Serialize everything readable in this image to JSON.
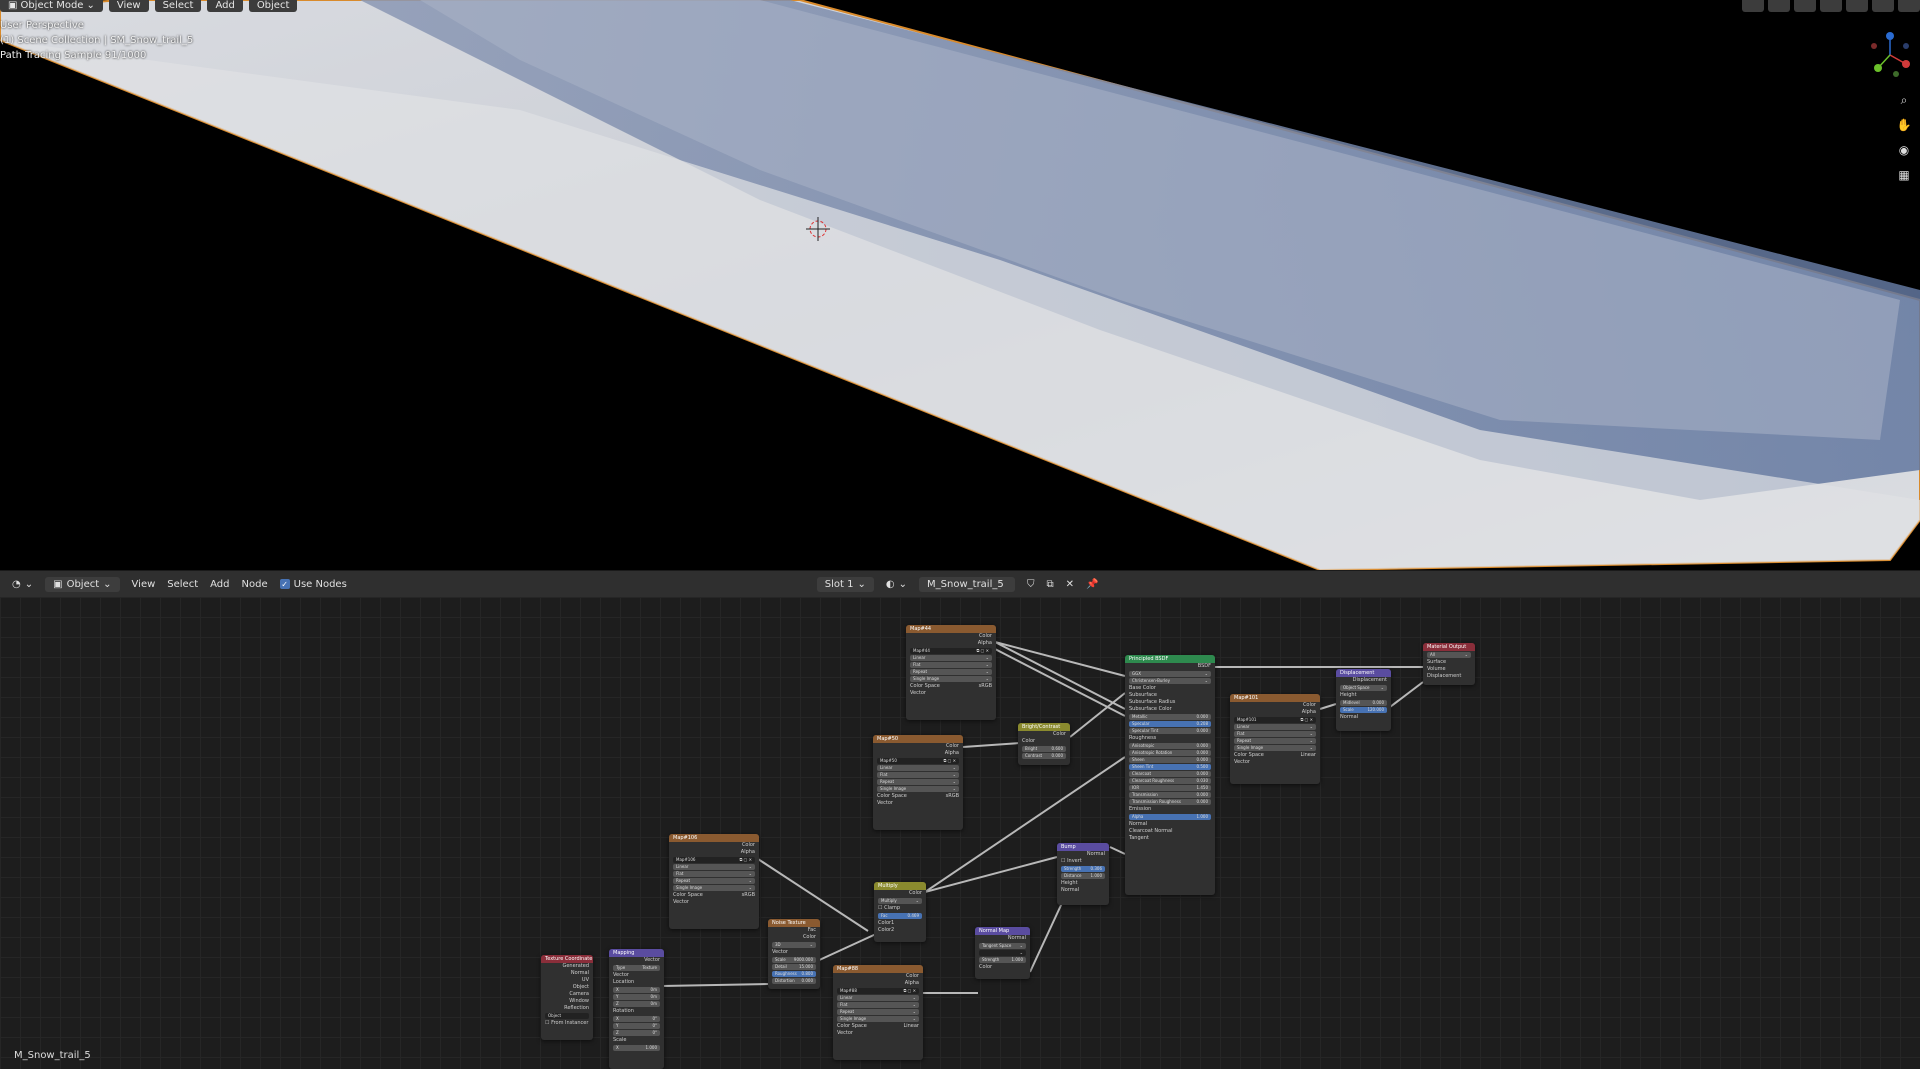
{
  "viewport": {
    "mode": "Object Mode",
    "menu": [
      "View",
      "Select",
      "Add",
      "Object"
    ],
    "overlay": {
      "perspective": "User Perspective",
      "collection": "(1) Scene Collection | SM_Snow_trail_5",
      "samples": "Path Tracing Sample 91/1000"
    },
    "gizmo_axes": [
      "x-axis",
      "y-axis",
      "z-axis"
    ],
    "nav_icons": [
      "zoom-icon",
      "hand-icon",
      "camera-icon",
      "grid-icon"
    ]
  },
  "node_editor": {
    "header": {
      "editor_type": "Object",
      "menu": [
        "View",
        "Select",
        "Add",
        "Node"
      ],
      "use_nodes_label": "Use Nodes",
      "slot": "Slot 1",
      "material": "M_Snow_trail_5"
    },
    "bottom_label": "M_Snow_trail_5",
    "nodes": {
      "map44": {
        "title": "Map#44",
        "image": "Map#44"
      },
      "map50": {
        "title": "Map#50",
        "image": "Map#50"
      },
      "map106": {
        "title": "Map#106",
        "image": "Map#106"
      },
      "map88": {
        "title": "Map#88",
        "image": "Map#88"
      },
      "map101": {
        "title": "Map#101",
        "image": "Map#101"
      },
      "bright": {
        "title": "Bright/Contrast"
      },
      "bsdf": {
        "title": "Principled BSDF"
      },
      "displacement": {
        "title": "Displacement"
      },
      "output": {
        "title": "Material Output"
      },
      "noise": {
        "title": "Noise Texture"
      },
      "multiply": {
        "title": "Multiply"
      },
      "bump": {
        "title": "Bump"
      },
      "normalmap": {
        "title": "Normal Map"
      },
      "texcoord": {
        "title": "Texture Coordinate"
      },
      "mapping": {
        "title": "Mapping"
      }
    }
  }
}
